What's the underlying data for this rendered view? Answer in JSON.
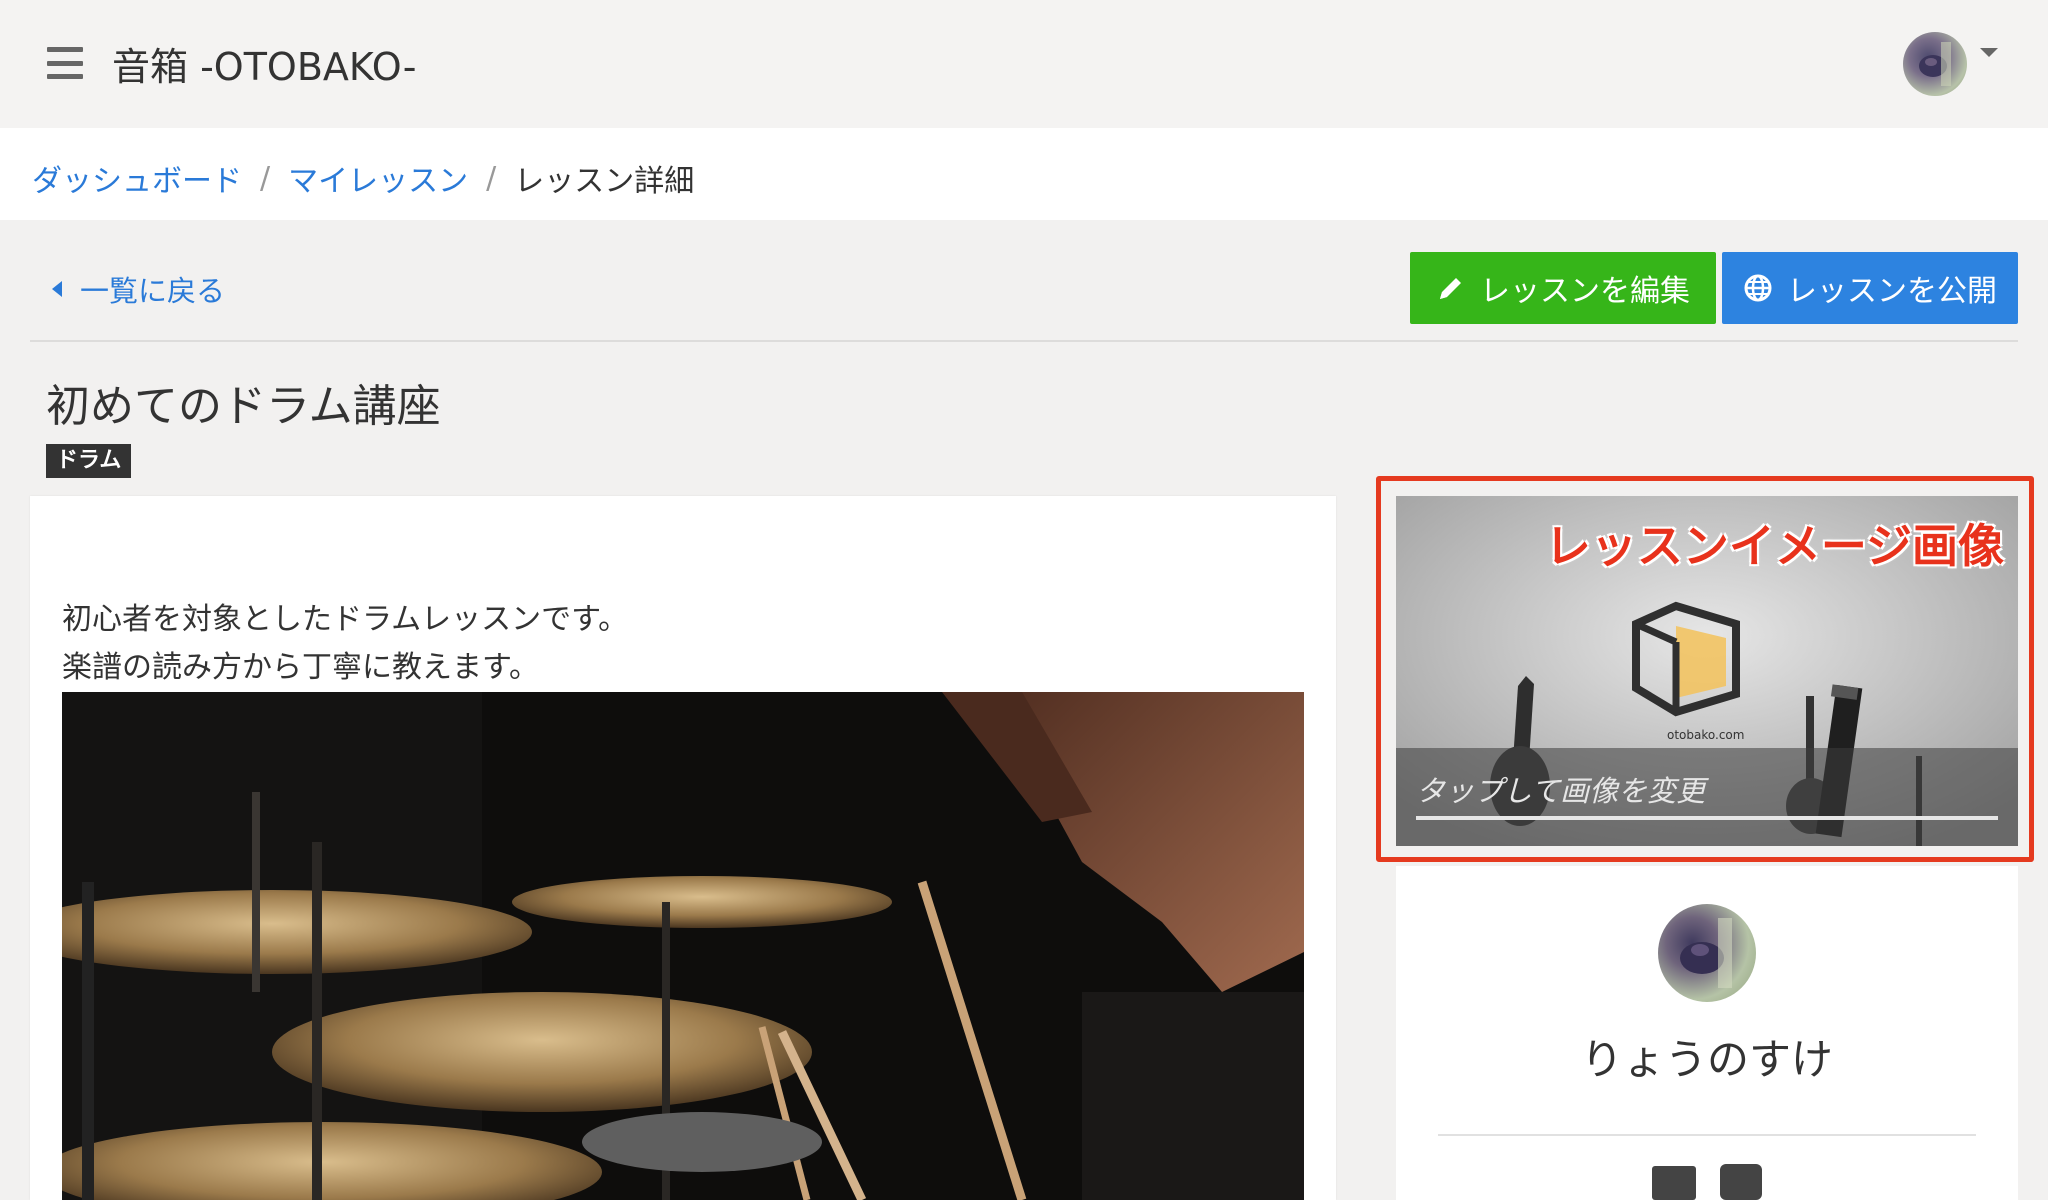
{
  "header": {
    "app_title": "音箱 -OTOBAKO-",
    "menu_icon": "hamburger-menu-icon",
    "avatar_icon": "user-avatar"
  },
  "breadcrumb": {
    "items": [
      {
        "label": "ダッシュボード",
        "link": true
      },
      {
        "label": "マイレッスン",
        "link": true
      },
      {
        "label": "レッスン詳細",
        "link": false
      }
    ],
    "separator": "/"
  },
  "toolbar": {
    "back_label": "一覧に戻る",
    "edit_label": "レッスンを編集",
    "publish_label": "レッスンを公開"
  },
  "lesson": {
    "title": "初めてのドラム講座",
    "tag": "ドラム",
    "description_lines": [
      "初心者を対象としたドラムレッスンです。",
      "楽譜の読み方から丁寧に教えます。"
    ]
  },
  "image_card": {
    "annotation_label": "レッスンイメージ画像",
    "overlay_text": "タップして画像を変更",
    "logo_caption": "otobako.com"
  },
  "profile": {
    "name": "りょうのすけ"
  },
  "colors": {
    "accent_link": "#2a7ad8",
    "edit_button": "#36b519",
    "publish_button": "#2d83e0",
    "highlight": "#e53a1f"
  }
}
